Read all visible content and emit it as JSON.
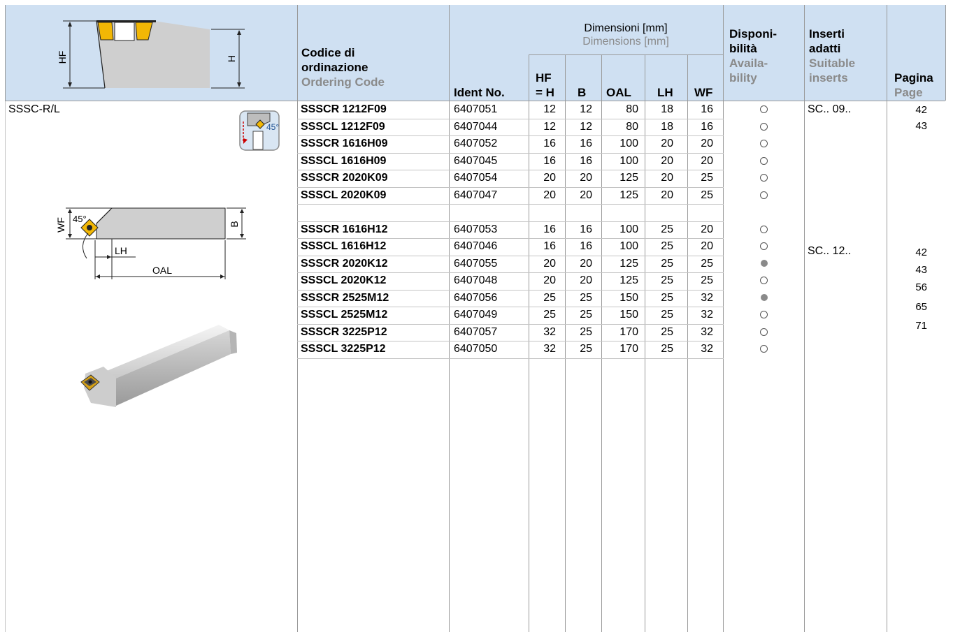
{
  "header": {
    "col_code": [
      "Codice di",
      "ordinazione",
      "Ordering Code"
    ],
    "col_ident": "Ident No.",
    "dims_title": [
      "Dimensioni [mm]",
      "Dimensions [mm]"
    ],
    "col_hf": [
      "HF",
      "= H"
    ],
    "col_b": "B",
    "col_oal": "OAL",
    "col_lh": "LH",
    "col_wf": "WF",
    "col_avail": [
      "Disponi-",
      "bilità",
      "Availa-",
      "bility"
    ],
    "col_inserts": [
      "Inserti",
      "adatti",
      "Suitable",
      "inserts"
    ],
    "col_page": [
      "Pagina",
      "Page"
    ]
  },
  "drawing": {
    "hf_label": "HF",
    "h_label": "H",
    "wf_label": "WF",
    "angle_label": "45°",
    "b_label": "B",
    "lh_label": "LH",
    "oal_label": "OAL",
    "icon_angle": "45°"
  },
  "family": "SSSC-R/L",
  "rows": [
    {
      "code": "SSSCR 1212F09",
      "ident": "6407051",
      "hf": "12",
      "b": "12",
      "oal": "80",
      "lh": "18",
      "wf": "16",
      "avail": "open"
    },
    {
      "code": "SSSCL 1212F09",
      "ident": "6407044",
      "hf": "12",
      "b": "12",
      "oal": "80",
      "lh": "18",
      "wf": "16",
      "avail": "open"
    },
    {
      "code": "SSSCR 1616H09",
      "ident": "6407052",
      "hf": "16",
      "b": "16",
      "oal": "100",
      "lh": "20",
      "wf": "20",
      "avail": "open"
    },
    {
      "code": "SSSCL 1616H09",
      "ident": "6407045",
      "hf": "16",
      "b": "16",
      "oal": "100",
      "lh": "20",
      "wf": "20",
      "avail": "open"
    },
    {
      "code": "SSSCR 2020K09",
      "ident": "6407054",
      "hf": "20",
      "b": "20",
      "oal": "125",
      "lh": "20",
      "wf": "25",
      "avail": "open"
    },
    {
      "code": "SSSCL 2020K09",
      "ident": "6407047",
      "hf": "20",
      "b": "20",
      "oal": "125",
      "lh": "20",
      "wf": "25",
      "avail": "open"
    },
    {
      "code": "",
      "ident": "",
      "hf": "",
      "b": "",
      "oal": "",
      "lh": "",
      "wf": "",
      "avail": ""
    },
    {
      "code": "SSSCR 1616H12",
      "ident": "6407053",
      "hf": "16",
      "b": "16",
      "oal": "100",
      "lh": "25",
      "wf": "20",
      "avail": "open"
    },
    {
      "code": "SSSCL 1616H12",
      "ident": "6407046",
      "hf": "16",
      "b": "16",
      "oal": "100",
      "lh": "25",
      "wf": "20",
      "avail": "open"
    },
    {
      "code": "SSSCR 2020K12",
      "ident": "6407055",
      "hf": "20",
      "b": "20",
      "oal": "125",
      "lh": "25",
      "wf": "25",
      "avail": "full"
    },
    {
      "code": "SSSCL 2020K12",
      "ident": "6407048",
      "hf": "20",
      "b": "20",
      "oal": "125",
      "lh": "25",
      "wf": "25",
      "avail": "open"
    },
    {
      "code": "SSSCR 2525M12",
      "ident": "6407056",
      "hf": "25",
      "b": "25",
      "oal": "150",
      "lh": "25",
      "wf": "32",
      "avail": "full"
    },
    {
      "code": "SSSCL 2525M12",
      "ident": "6407049",
      "hf": "25",
      "b": "25",
      "oal": "150",
      "lh": "25",
      "wf": "32",
      "avail": "open"
    },
    {
      "code": "SSSCR 3225P12",
      "ident": "6407057",
      "hf": "32",
      "b": "25",
      "oal": "170",
      "lh": "25",
      "wf": "32",
      "avail": "open"
    },
    {
      "code": "SSSCL 3225P12",
      "ident": "6407050",
      "hf": "32",
      "b": "25",
      "oal": "170",
      "lh": "25",
      "wf": "32",
      "avail": "open"
    }
  ],
  "inserts": [
    "SC.. 09..",
    "SC.. 12.."
  ],
  "pages_group1": [
    "42",
    "43"
  ],
  "pages_group2": [
    "42",
    "43",
    "56",
    "65",
    "71"
  ]
}
